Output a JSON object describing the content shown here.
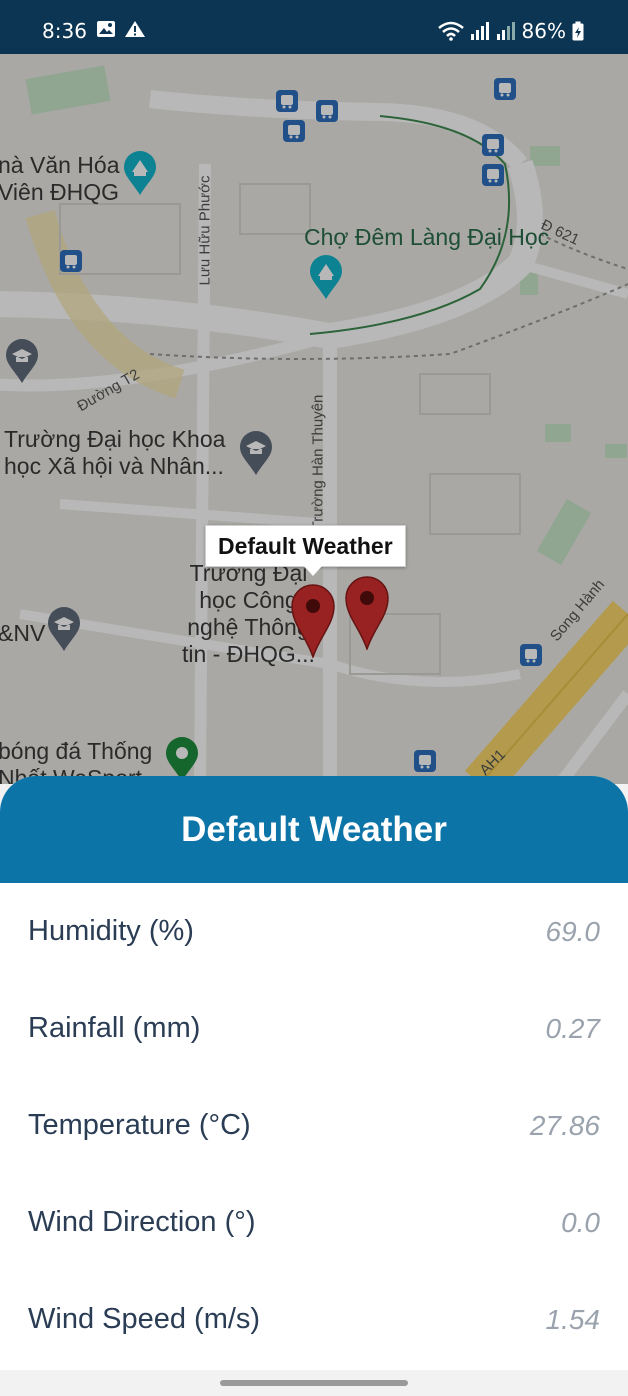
{
  "status_bar": {
    "time": "8:36",
    "battery": "86%"
  },
  "map": {
    "labels": {
      "van_hoa": "nà Văn Hóa\nViên ĐHQG",
      "cho_dem": "Chợ Đêm Làng Đại Học",
      "truong_khxh": "Trường Đại học Khoa\nhọc Xã hội và Nhân...",
      "truong_cntt": "Trường Đại\nhọc Công\nnghệ Thông\ntin - ĐHQG...",
      "nv": "&NV",
      "bong_da": "bóng đá Thống\nNhất WeSport"
    },
    "roads": {
      "luu_huu_phuoc": "Lưu Hữu Phước",
      "duong_t2": "Đường T2",
      "han_thuyen": "Trường Hàn Thuyên",
      "song_hanh": "Song Hành",
      "d621": "Đ 621",
      "ah1": "AH1"
    },
    "info_window": "Default Weather"
  },
  "sheet": {
    "title": "Default Weather",
    "rows": [
      {
        "label": "Humidity (%)",
        "value": "69.0"
      },
      {
        "label": "Rainfall (mm)",
        "value": "0.27"
      },
      {
        "label": "Temperature (°C)",
        "value": "27.86"
      },
      {
        "label": "Wind Direction (°)",
        "value": "0.0"
      },
      {
        "label": "Wind Speed (m/s)",
        "value": "1.54"
      }
    ]
  },
  "colors": {
    "status_bar": "#0b3552",
    "sheet_header": "#0d74a7",
    "label_text": "#2a3d54",
    "value_text": "#9aa3ad",
    "marker": "#b71c1c"
  }
}
